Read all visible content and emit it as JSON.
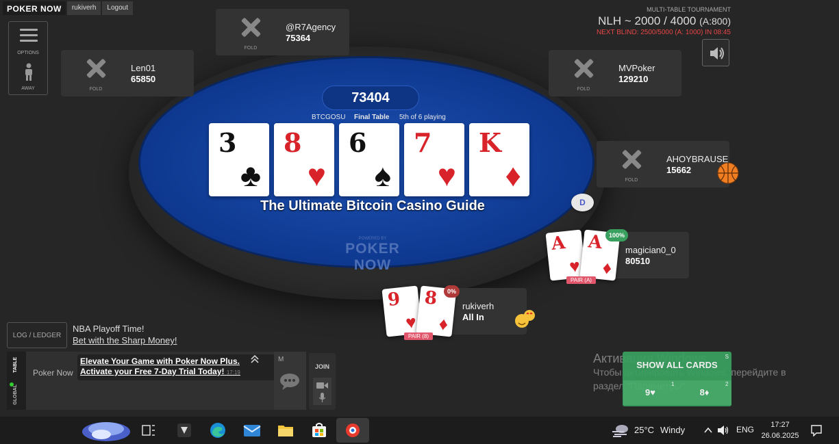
{
  "topbar": {
    "logo": "POKER NOW",
    "user": "rukiverh",
    "logout": "Logout"
  },
  "options": {
    "options_label": "OPTIONS",
    "away_label": "AWAY"
  },
  "header": {
    "tournament": "MULTI-TABLE TOURNAMENT",
    "blinds": "NLH ~ 2000 / 4000",
    "ante": "(A:800)",
    "next_blind": "NEXT BLIND: 2500/5000 (A: 1000) IN 08:45"
  },
  "table": {
    "pot": "73404",
    "name": "BTCGOSU",
    "stage": "Final Table",
    "playing": "5th of 6 playing",
    "banner": "The Ultimate Bitcoin Casino Guide",
    "powered_by": "POWERED BY",
    "powered_brand": "POKER NOW",
    "dealer_button": "D"
  },
  "board": [
    {
      "rank": "3",
      "suit": "♣",
      "color": "black"
    },
    {
      "rank": "8",
      "suit": "♥",
      "color": "red"
    },
    {
      "rank": "6",
      "suit": "♠",
      "color": "black"
    },
    {
      "rank": "7",
      "suit": "♥",
      "color": "red"
    },
    {
      "rank": "K",
      "suit": "♦",
      "color": "red"
    }
  ],
  "seats": {
    "r7agency": {
      "name": "@R7Agency",
      "chips": "75364",
      "status": "FOLD"
    },
    "len01": {
      "name": "Len01",
      "chips": "65850",
      "status": "FOLD"
    },
    "mvpoker": {
      "name": "MVPoker",
      "chips": "129210",
      "status": "FOLD"
    },
    "ahoybrause": {
      "name": "AHOYBRAUSE",
      "chips": "15662",
      "status": "FOLD"
    },
    "magician": {
      "name": "magician0_0",
      "chips": "80510",
      "equity": "100%",
      "hand": "PAIR (A)",
      "cards": [
        {
          "rank": "A",
          "suit": "♥"
        },
        {
          "rank": "A",
          "suit": "♦"
        }
      ]
    },
    "rukiverh": {
      "name": "rukiverh",
      "chips": "All In",
      "equity": "0%",
      "hand": "PAIR (8)",
      "cards": [
        {
          "rank": "9",
          "suit": "♥"
        },
        {
          "rank": "8",
          "suit": "♦"
        }
      ]
    }
  },
  "bottom": {
    "ledger": "LOG / LEDGER",
    "promo_title": "NBA Playoff Time!",
    "promo_link": "Bet with the Sharp Money!",
    "chat_tab_table": "TABLE",
    "chat_tab_global": "GLOBAL",
    "chat_sender": "Poker Now",
    "chat_line1": "Elevate Your Game with Poker Now Plus.",
    "chat_line2": "Activate your Free 7-Day Trial Today!",
    "chat_time": "17:19",
    "chat_m": "M",
    "join": "JOIN"
  },
  "show_cards": {
    "label": "SHOW ALL CARDS",
    "card1": "9♥",
    "card2": "8♦",
    "key_s": "S",
    "key_1": "1",
    "key_2": "2"
  },
  "windows_activation": {
    "title": "Активация Windows",
    "line1": "Чтобы активировать Windows, перейдите в",
    "line2": "раздел \"Параметры\"."
  },
  "taskbar": {
    "weather_temp": "25°C",
    "weather_desc": "Windy",
    "lang": "ENG",
    "time": "17:27",
    "date": "26.06.2025"
  },
  "colors": {
    "felt": "#1c4fb0",
    "green": "#3aa060",
    "red_text": "#e84545",
    "equity_win": "#3aa060",
    "equity_lose": "#b03a3a"
  }
}
